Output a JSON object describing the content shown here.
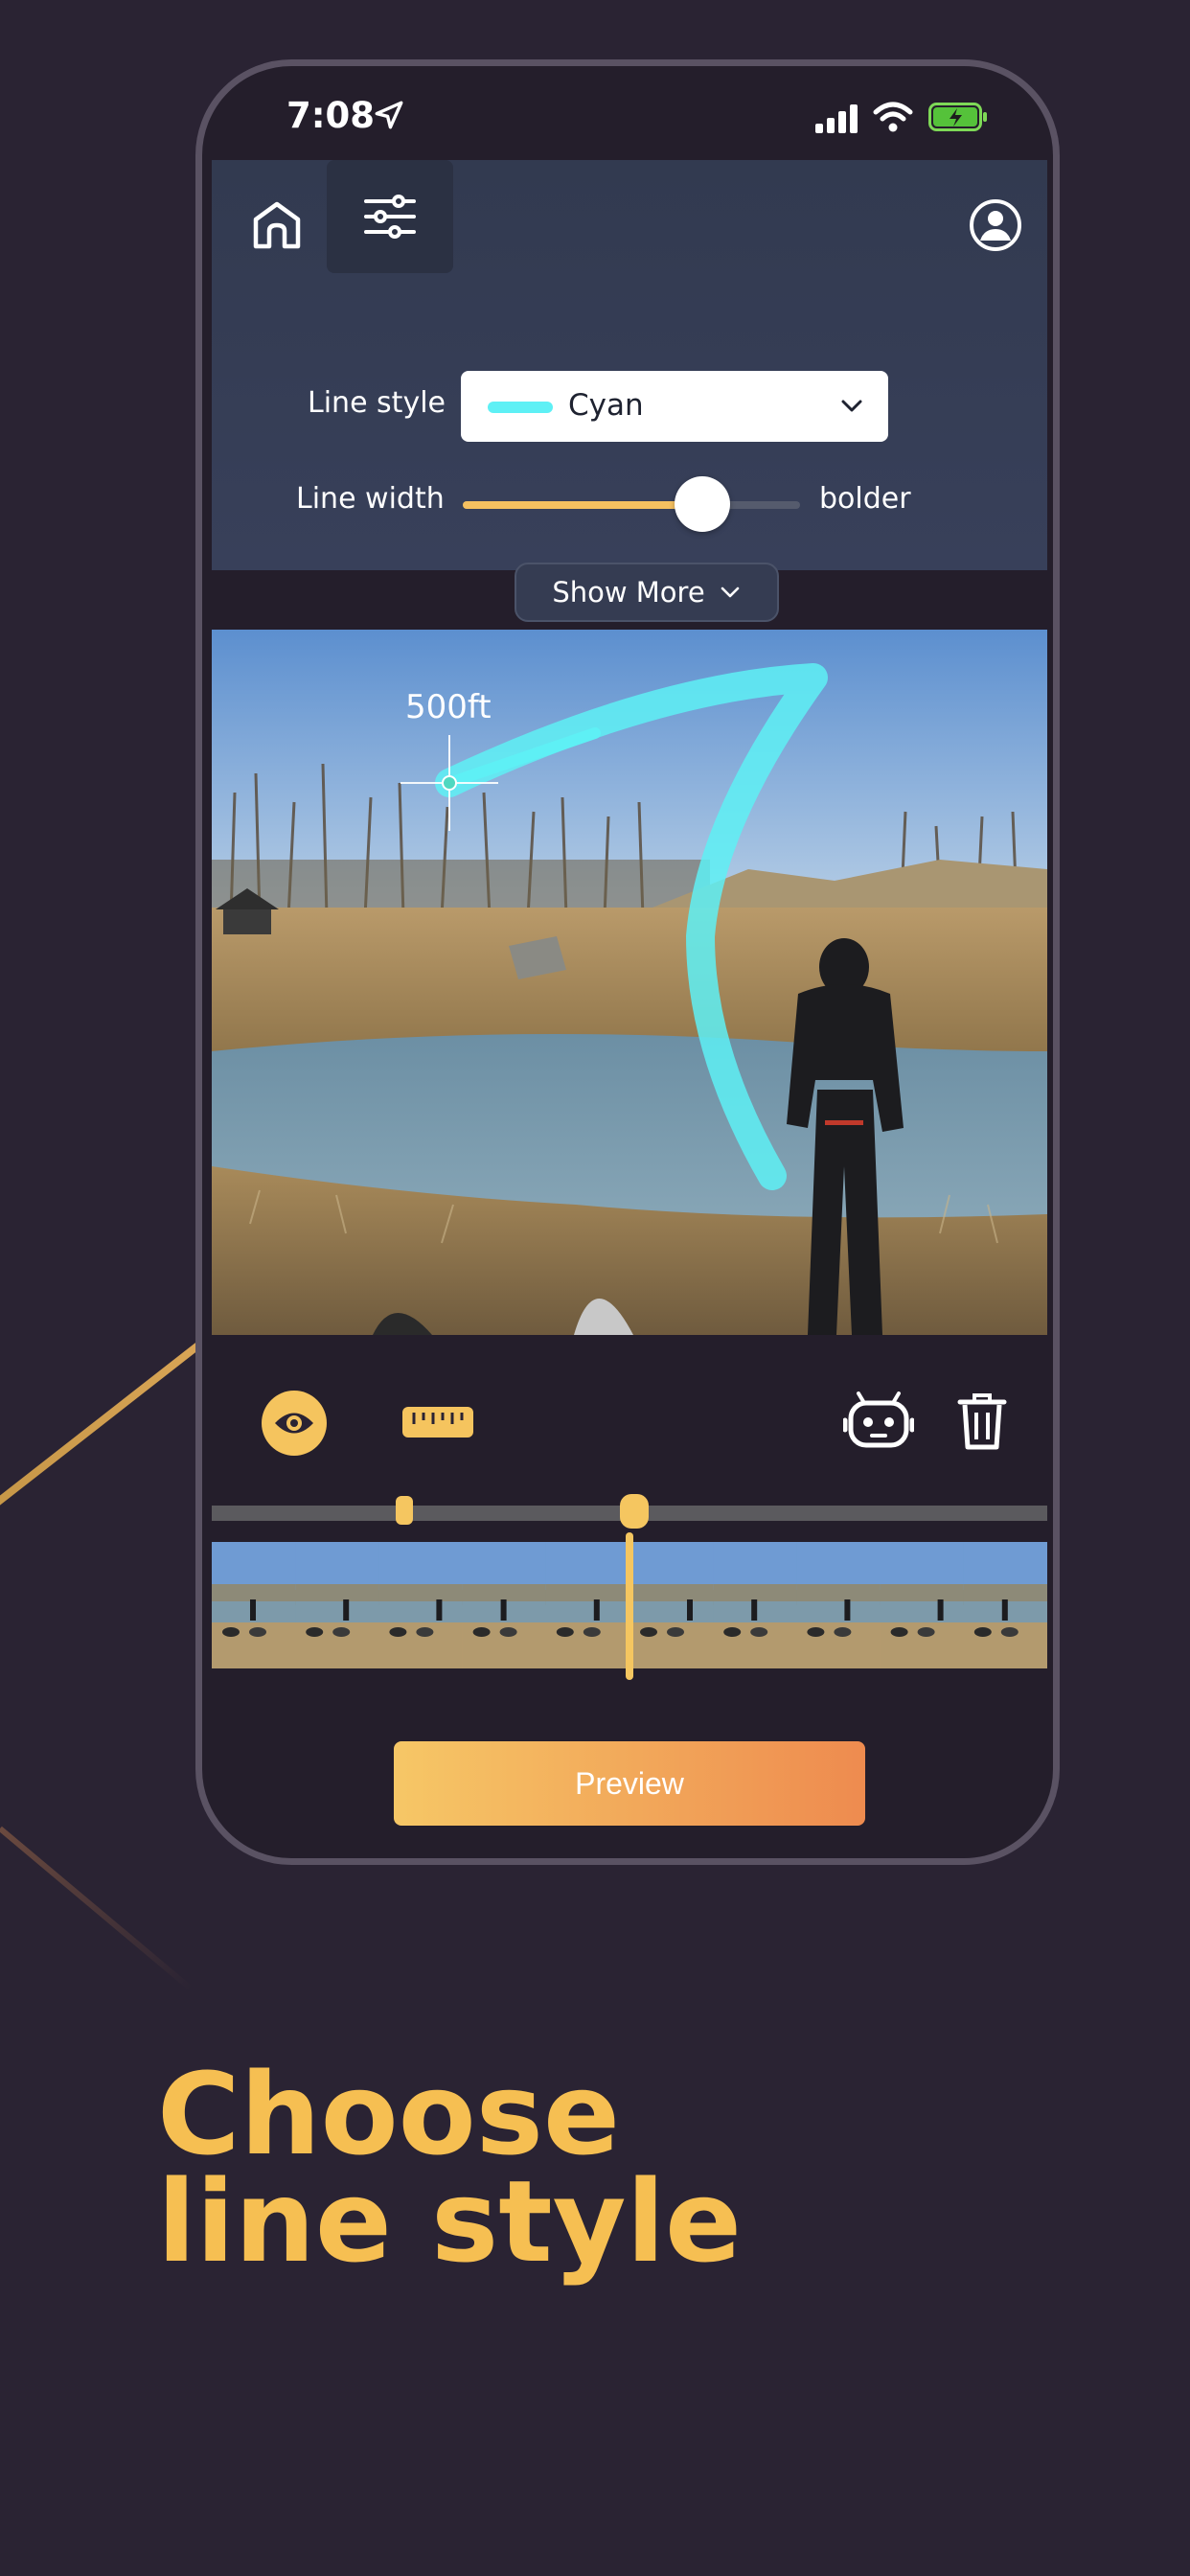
{
  "status_bar": {
    "time": "7:08"
  },
  "controls": {
    "line_style_label": "Line style",
    "line_style_value": "Cyan",
    "line_style_swatch_color": "#5ef0f5",
    "line_width_label": "Line width",
    "line_width_max_label": "bolder",
    "line_width_level": 0.71,
    "show_more_label": "Show More"
  },
  "photo": {
    "distance_label": "500ft",
    "line_color": "#5ef0f5"
  },
  "toolbar": {
    "icons": [
      "eye-icon",
      "ruler-icon",
      "robot-icon",
      "trash-icon"
    ]
  },
  "timeline": {
    "trim_start": 0.23,
    "playhead": 0.5
  },
  "preview_label": "Preview",
  "headline": {
    "line1": "Choose",
    "line2": "line style"
  },
  "colors": {
    "accent": "#f5c660",
    "background": "#2a2333",
    "panel": "#353c52"
  }
}
